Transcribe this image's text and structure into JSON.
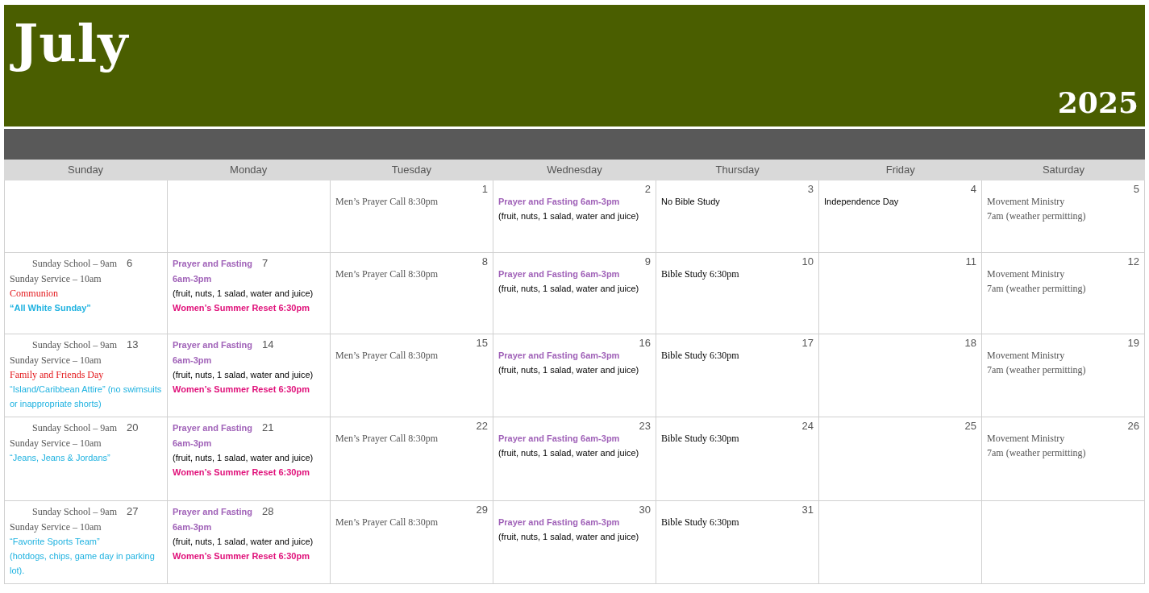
{
  "month": "July",
  "year": "2025",
  "weekdays": [
    "Sunday",
    "Monday",
    "Tuesday",
    "Wednesday",
    "Thursday",
    "Friday",
    "Saturday"
  ],
  "weeks": [
    {
      "days": [
        {
          "kind": "empty"
        },
        {
          "kind": "empty"
        },
        {
          "kind": "corner",
          "date": "1",
          "lines": [
            {
              "kind": "event",
              "text": "Men’s Prayer Call 8:30pm"
            }
          ]
        },
        {
          "kind": "corner",
          "date": "2",
          "lines": [
            {
              "kind": "fasting",
              "text": "Prayer and Fasting 6am-3pm"
            },
            {
              "kind": "note",
              "text": "(fruit, nuts, 1 salad, water and juice)"
            }
          ]
        },
        {
          "kind": "corner",
          "date": "3",
          "lines": [
            {
              "kind": "note",
              "text": "No Bible Study"
            }
          ]
        },
        {
          "kind": "corner",
          "date": "4",
          "lines": [
            {
              "kind": "note",
              "text": "Independence Day"
            }
          ]
        },
        {
          "kind": "corner",
          "date": "5",
          "lines": [
            {
              "kind": "event",
              "text": "Movement Ministry"
            },
            {
              "kind": "event",
              "text": "7am (weather permitting)"
            }
          ]
        }
      ]
    },
    {
      "days": [
        {
          "kind": "inline",
          "date": "6",
          "lines": [
            {
              "kind": "indented",
              "text": "Sunday School – 9am"
            },
            {
              "kind": "event",
              "text": "Sunday Service – 10am"
            },
            {
              "kind": "occasion",
              "text": "Communion"
            },
            {
              "kind": "headline",
              "text": "“All White Sunday”"
            }
          ]
        },
        {
          "kind": "inline",
          "date": "7",
          "lines": [
            {
              "kind": "fasting",
              "text": "Prayer and Fasting"
            },
            {
              "kind": "fasting",
              "text": "6am-3pm"
            },
            {
              "kind": "note",
              "text": "(fruit, nuts, 1 salad, water and juice)"
            },
            {
              "kind": "reset",
              "text": "Women’s Summer Reset 6:30pm"
            }
          ]
        },
        {
          "kind": "corner",
          "date": "8",
          "lines": [
            {
              "kind": "event",
              "text": "Men’s Prayer Call 8:30pm"
            }
          ]
        },
        {
          "kind": "corner",
          "date": "9",
          "lines": [
            {
              "kind": "fasting",
              "text": "Prayer and Fasting 6am-3pm"
            },
            {
              "kind": "note",
              "text": "(fruit, nuts, 1 salad, water and juice)"
            }
          ]
        },
        {
          "kind": "corner",
          "date": "10",
          "lines": [
            {
              "kind": "study",
              "text": "Bible Study 6:30pm"
            }
          ]
        },
        {
          "kind": "corner",
          "date": "11"
        },
        {
          "kind": "corner",
          "date": "12",
          "lines": [
            {
              "kind": "event",
              "text": "Movement Ministry"
            },
            {
              "kind": "event",
              "text": "7am (weather permitting)"
            }
          ]
        }
      ]
    },
    {
      "days": [
        {
          "kind": "inline",
          "date": "13",
          "lines": [
            {
              "kind": "indented",
              "text": "Sunday School – 9am"
            },
            {
              "kind": "event",
              "text": "Sunday Service – 10am"
            },
            {
              "kind": "occasion",
              "text": "Family and Friends Day"
            },
            {
              "kind": "attire",
              "text": "“Island/Caribbean Attire” (no swimsuits or inappropriate shorts)"
            }
          ]
        },
        {
          "kind": "inline",
          "date": "14",
          "lines": [
            {
              "kind": "fasting",
              "text": "Prayer and Fasting"
            },
            {
              "kind": "fasting",
              "text": "6am-3pm"
            },
            {
              "kind": "note",
              "text": "(fruit, nuts, 1 salad, water and juice)"
            },
            {
              "kind": "reset",
              "text": "Women’s Summer Reset 6:30pm"
            }
          ]
        },
        {
          "kind": "corner",
          "date": "15",
          "lines": [
            {
              "kind": "event",
              "text": "Men’s Prayer Call 8:30pm"
            }
          ]
        },
        {
          "kind": "corner",
          "date": "16",
          "lines": [
            {
              "kind": "fasting",
              "text": "Prayer and Fasting 6am-3pm"
            },
            {
              "kind": "note",
              "text": "(fruit, nuts, 1 salad, water and juice)"
            }
          ]
        },
        {
          "kind": "corner",
          "date": "17",
          "lines": [
            {
              "kind": "study",
              "text": "Bible Study 6:30pm"
            }
          ]
        },
        {
          "kind": "corner",
          "date": "18"
        },
        {
          "kind": "corner",
          "date": "19",
          "lines": [
            {
              "kind": "event",
              "text": "Movement Ministry"
            },
            {
              "kind": "event",
              "text": "7am (weather permitting)"
            }
          ]
        }
      ]
    },
    {
      "days": [
        {
          "kind": "inline",
          "date": "20",
          "lines": [
            {
              "kind": "indented",
              "text": "Sunday School – 9am"
            },
            {
              "kind": "event",
              "text": "Sunday Service – 10am"
            },
            {
              "kind": "attire",
              "text": "“Jeans, Jeans & Jordans”"
            }
          ]
        },
        {
          "kind": "inline",
          "date": "21",
          "lines": [
            {
              "kind": "fasting",
              "text": "Prayer and Fasting"
            },
            {
              "kind": "fasting",
              "text": "6am-3pm"
            },
            {
              "kind": "note",
              "text": "(fruit, nuts, 1 salad, water and juice)"
            },
            {
              "kind": "reset",
              "text": "Women’s Summer Reset 6:30pm"
            }
          ]
        },
        {
          "kind": "corner",
          "date": "22",
          "lines": [
            {
              "kind": "event",
              "text": "Men’s Prayer Call 8:30pm"
            }
          ]
        },
        {
          "kind": "corner",
          "date": "23",
          "lines": [
            {
              "kind": "fasting",
              "text": "Prayer and Fasting 6am-3pm"
            },
            {
              "kind": "note",
              "text": "(fruit, nuts, 1 salad, water and juice)"
            }
          ]
        },
        {
          "kind": "corner",
          "date": "24",
          "lines": [
            {
              "kind": "study",
              "text": "Bible Study 6:30pm"
            }
          ]
        },
        {
          "kind": "corner",
          "date": "25"
        },
        {
          "kind": "corner",
          "date": "26",
          "lines": [
            {
              "kind": "event",
              "text": "Movement Ministry"
            },
            {
              "kind": "event",
              "text": "7am (weather permitting)"
            }
          ]
        }
      ]
    },
    {
      "days": [
        {
          "kind": "inline",
          "date": "27",
          "lines": [
            {
              "kind": "indented",
              "text": "Sunday School – 9am"
            },
            {
              "kind": "event",
              "text": "Sunday Service – 10am"
            },
            {
              "kind": "attire",
              "text": "“Favorite Sports Team”"
            },
            {
              "kind": "attire",
              "text": "(hotdogs, chips, game day in parking lot)."
            }
          ]
        },
        {
          "kind": "inline",
          "date": "28",
          "lines": [
            {
              "kind": "fasting",
              "text": "Prayer and Fasting"
            },
            {
              "kind": "fasting",
              "text": "6am-3pm"
            },
            {
              "kind": "note",
              "text": "(fruit, nuts, 1 salad, water and juice)"
            },
            {
              "kind": "reset",
              "text": "Women’s Summer Reset 6:30pm"
            }
          ]
        },
        {
          "kind": "corner",
          "date": "29",
          "lines": [
            {
              "kind": "event",
              "text": "Men’s Prayer Call 8:30pm"
            }
          ]
        },
        {
          "kind": "corner",
          "date": "30",
          "lines": [
            {
              "kind": "fasting",
              "text": "Prayer and Fasting 6am-3pm"
            },
            {
              "kind": "note",
              "text": "(fruit, nuts, 1 salad, water and juice)"
            }
          ]
        },
        {
          "kind": "corner",
          "date": "31",
          "lines": [
            {
              "kind": "study",
              "text": "Bible Study 6:30pm"
            }
          ]
        },
        {
          "kind": "empty"
        },
        {
          "kind": "empty"
        }
      ]
    }
  ]
}
